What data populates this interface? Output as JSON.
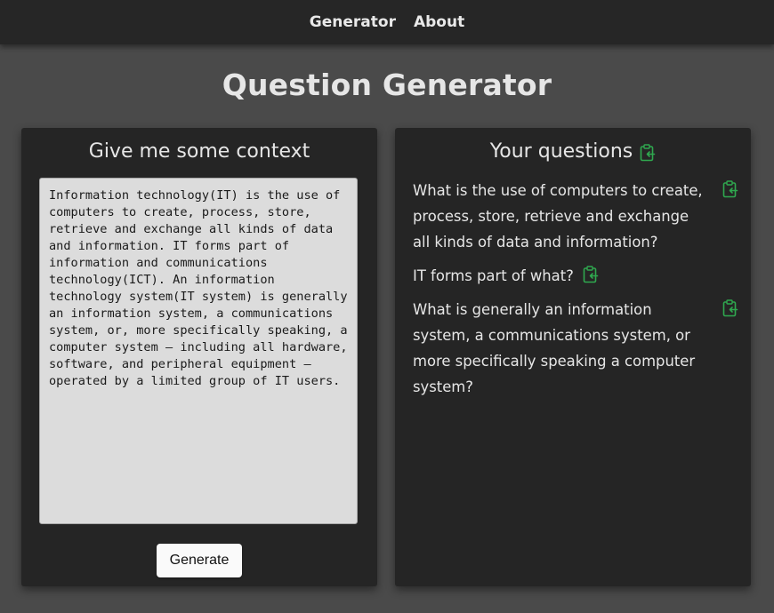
{
  "nav": {
    "items": [
      "Generator",
      "About"
    ]
  },
  "page": {
    "title": "Question Generator"
  },
  "context_panel": {
    "title": "Give me some context",
    "text": "Information technology(IT) is the use of computers to create, process, store, retrieve and exchange all kinds of data and information. IT forms part of information and communications technology(ICT). An information technology system(IT system) is generally an information system, a communications system, or, more specifically speaking, a computer system — including all hardware, software, and peripheral equipment — operated by a limited group of IT users.",
    "generate_label": "Generate"
  },
  "questions_panel": {
    "title": "Your questions",
    "questions": [
      "What is the use of computers to create, process, store, retrieve and exchange all kinds of data and information?",
      "IT forms part of what?",
      "What is generally an information system, a communications system, or more specifically speaking a computer system?"
    ]
  },
  "colors": {
    "accent": "#2fa84f",
    "background": "#4a4a4a",
    "panel": "#252525"
  },
  "icons": {
    "copy": "clipboard-copy-icon"
  }
}
